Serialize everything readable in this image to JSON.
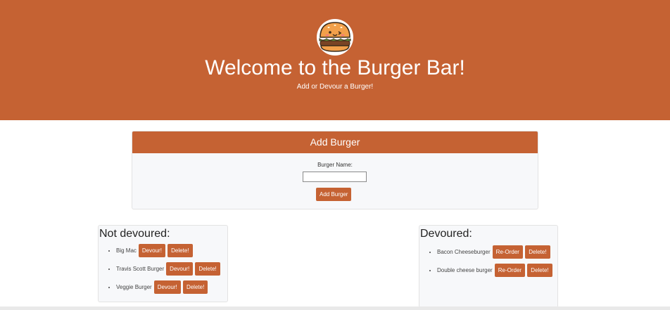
{
  "header": {
    "title": "Welcome to the Burger Bar!",
    "subtitle": "Add or Devour a Burger!",
    "logo_icon": "burger-icon"
  },
  "add_form": {
    "heading": "Add Burger",
    "field_label": "Burger Name:",
    "field_value": "",
    "submit_label": "Add Burger"
  },
  "not_devoured": {
    "heading": "Not devoured:",
    "items": [
      {
        "name": "Big Mac",
        "action": "Devour!",
        "delete": "Delete!"
      },
      {
        "name": "Travis Scott Burger",
        "action": "Devour!",
        "delete": "Delete!"
      },
      {
        "name": "Veggie Burger",
        "action": "Devour!",
        "delete": "Delete!"
      }
    ]
  },
  "devoured": {
    "heading": "Devoured:",
    "items": [
      {
        "name": "Bacon Cheeseburger",
        "action": "Re-Order",
        "delete": "Delete!"
      },
      {
        "name": "Double cheese burger",
        "action": "Re-Order",
        "delete": "Delete!"
      }
    ]
  },
  "colors": {
    "brand": "#c56233",
    "panel_bg": "#f7f8fa"
  }
}
